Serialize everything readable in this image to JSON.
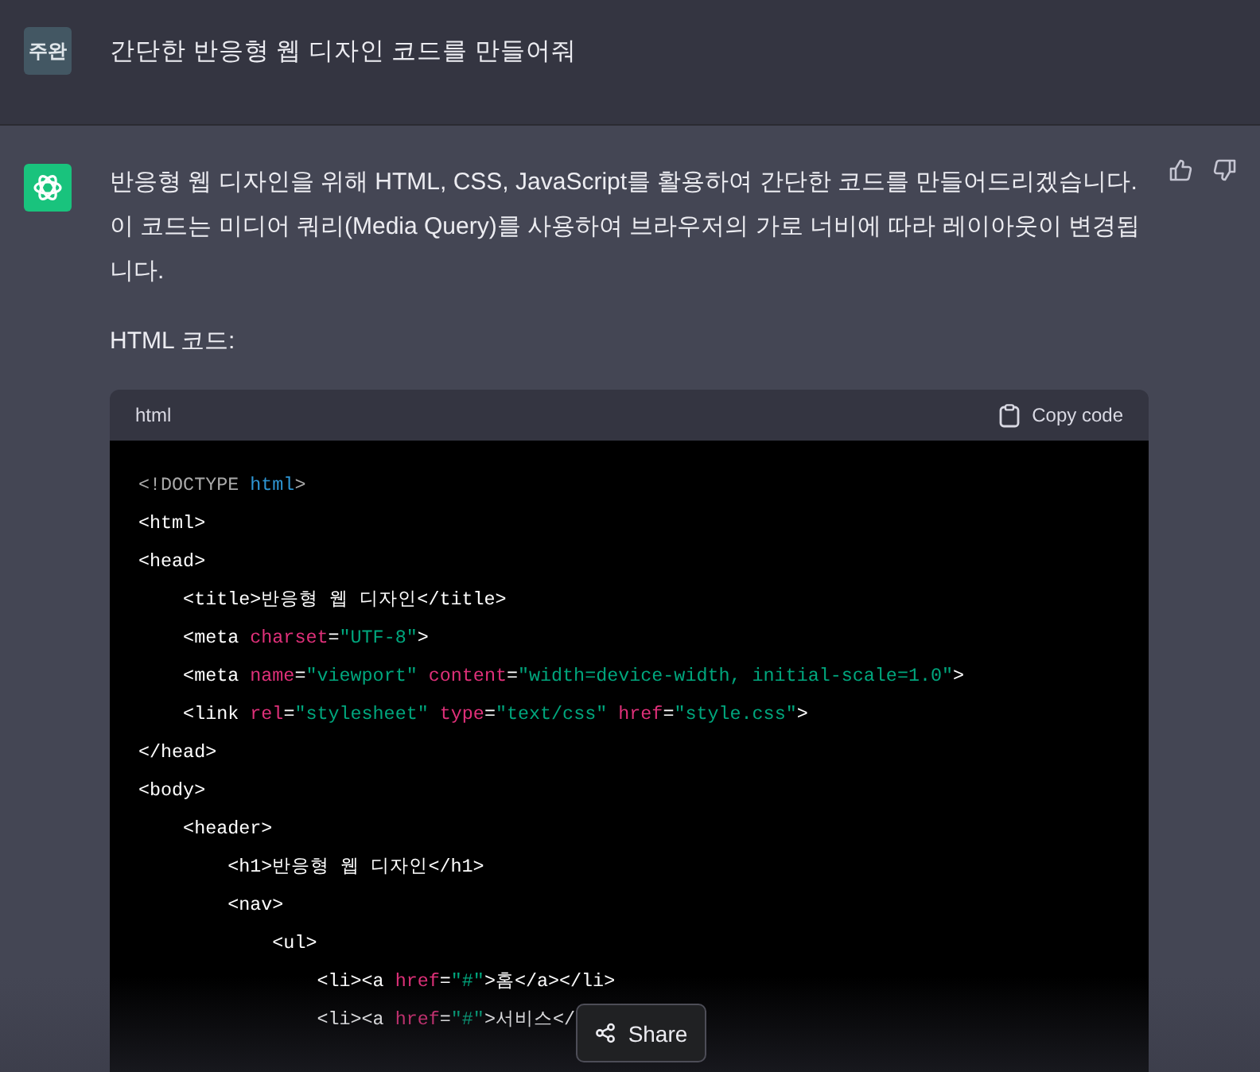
{
  "user_message": {
    "avatar": "주완",
    "text": "간단한 반응형 웹 디자인 코드를 만들어줘"
  },
  "assistant_message": {
    "paragraphs": [
      "반응형 웹 디자인을 위해 HTML, CSS, JavaScript를 활용하여 간단한 코드를 만들어드리겠습니다. 이 코드는 미디어 쿼리(Media Query)를 사용하여 브라우저의 가로 너비에 따라 레이아웃이 변경됩니다.",
      "HTML 코드:"
    ],
    "code_block": {
      "language": "html",
      "copy_label": "Copy code",
      "lines": [
        [
          {
            "kind": "doctype",
            "text": "<!DOCTYPE "
          },
          {
            "kind": "keyword",
            "text": "html"
          },
          {
            "kind": "doctype",
            "text": ">"
          }
        ],
        [
          {
            "kind": "tag",
            "text": "<html>"
          }
        ],
        [
          {
            "kind": "tag",
            "text": "<head>"
          }
        ],
        [
          {
            "kind": "tag",
            "text": "    <title>반응형 웹 디자인</title>"
          }
        ],
        [
          {
            "kind": "tag",
            "text": "    <meta "
          },
          {
            "kind": "attr",
            "text": "charset"
          },
          {
            "kind": "tag",
            "text": "="
          },
          {
            "kind": "string",
            "text": "\"UTF-8\""
          },
          {
            "kind": "tag",
            "text": ">"
          }
        ],
        [
          {
            "kind": "tag",
            "text": "    <meta "
          },
          {
            "kind": "attr",
            "text": "name"
          },
          {
            "kind": "tag",
            "text": "="
          },
          {
            "kind": "string",
            "text": "\"viewport\""
          },
          {
            "kind": "attr",
            "text": " content"
          },
          {
            "kind": "tag",
            "text": "="
          },
          {
            "kind": "string",
            "text": "\"width=device-width, initial-scale=1.0\""
          },
          {
            "kind": "tag",
            "text": ">"
          }
        ],
        [
          {
            "kind": "tag",
            "text": "    <link "
          },
          {
            "kind": "attr",
            "text": "rel"
          },
          {
            "kind": "tag",
            "text": "="
          },
          {
            "kind": "string",
            "text": "\"stylesheet\""
          },
          {
            "kind": "attr",
            "text": " type"
          },
          {
            "kind": "tag",
            "text": "="
          },
          {
            "kind": "string",
            "text": "\"text/css\""
          },
          {
            "kind": "attr",
            "text": " href"
          },
          {
            "kind": "tag",
            "text": "="
          },
          {
            "kind": "string",
            "text": "\"style.css\""
          },
          {
            "kind": "tag",
            "text": ">"
          }
        ],
        [
          {
            "kind": "tag",
            "text": "</head>"
          }
        ],
        [
          {
            "kind": "tag",
            "text": "<body>"
          }
        ],
        [
          {
            "kind": "tag",
            "text": "    <header>"
          }
        ],
        [
          {
            "kind": "tag",
            "text": "        <h1>반응형 웹 디자인</h1>"
          }
        ],
        [
          {
            "kind": "tag",
            "text": "        <nav>"
          }
        ],
        [
          {
            "kind": "tag",
            "text": "            <ul>"
          }
        ],
        [
          {
            "kind": "tag",
            "text": "                <li><a "
          },
          {
            "kind": "attr",
            "text": "href"
          },
          {
            "kind": "tag",
            "text": "="
          },
          {
            "kind": "string",
            "text": "\"#\""
          },
          {
            "kind": "tag",
            "text": ">홈</a></li>"
          }
        ],
        [
          {
            "kind": "tag",
            "text": "                <li><a "
          },
          {
            "kind": "attr",
            "text": "href"
          },
          {
            "kind": "tag",
            "text": "="
          },
          {
            "kind": "string",
            "text": "\"#\""
          },
          {
            "kind": "tag",
            "text": ">서비스</"
          }
        ]
      ]
    }
  },
  "share_button": {
    "label": "Share"
  }
}
